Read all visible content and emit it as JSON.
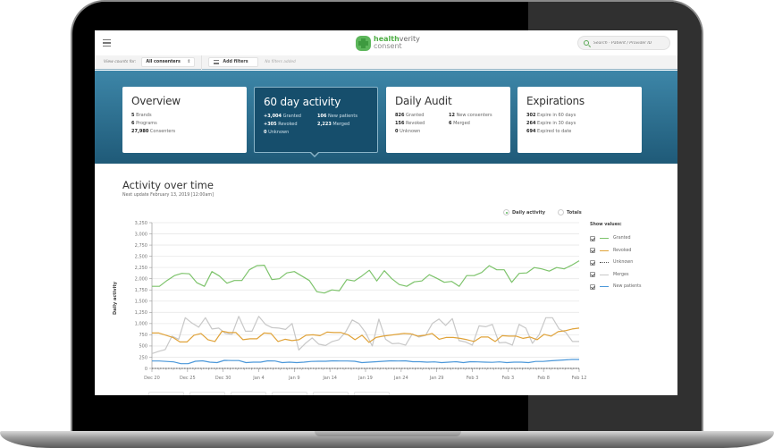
{
  "topbar": {
    "menu_icon": "hamburger-icon",
    "logo": {
      "brand_bold": "health",
      "brand_regular": "verity",
      "product": "consent"
    },
    "search": {
      "placeholder": "Search - Patient / Provider ID",
      "icon": "search-icon"
    }
  },
  "filterbar": {
    "view_counts_label": "View counts for:",
    "selected_view": "All consenters",
    "add_filters_label": "Add filters",
    "no_filters_text": "No filters added"
  },
  "cards": [
    {
      "title": "Overview",
      "stats": [
        {
          "value": "5",
          "label": "Brands"
        },
        {
          "value": "6",
          "label": "Programs"
        },
        {
          "value": "27,980",
          "label": "Consenters"
        }
      ]
    },
    {
      "title": "60 day activity",
      "active": true,
      "stats": [
        {
          "value": "+3,004",
          "label": "Granted"
        },
        {
          "value": "106",
          "label": "New patients"
        },
        {
          "value": "+305",
          "label": "Revoked"
        },
        {
          "value": "2,223",
          "label": "Merged"
        },
        {
          "value": "0",
          "label": "Unknown"
        }
      ]
    },
    {
      "title": "Daily Audit",
      "stats": [
        {
          "value": "826",
          "label": "Granted"
        },
        {
          "value": "12",
          "label": "New consenters"
        },
        {
          "value": "156",
          "label": "Revoked"
        },
        {
          "value": "6",
          "label": "Merged"
        },
        {
          "value": "0",
          "label": "Unknown"
        }
      ]
    },
    {
      "title": "Expirations",
      "stats": [
        {
          "value": "302",
          "label": "Expire in 60 days"
        },
        {
          "value": "264",
          "label": "Expire in 30 days"
        },
        {
          "value": "694",
          "label": "Expired to date"
        }
      ]
    }
  ],
  "activity": {
    "title": "Activity over time",
    "subtitle": "Next update February 13, 2019 [12:00am]",
    "mode_options": [
      {
        "label": "Daily activity",
        "selected": true
      },
      {
        "label": "Totals",
        "selected": false
      }
    ],
    "legend_title": "Show values:",
    "legend": [
      {
        "label": "Granted",
        "color": "#7dc36b",
        "checked": true,
        "style": "solid"
      },
      {
        "label": "Revoked",
        "color": "#e0a33a",
        "checked": true,
        "style": "solid"
      },
      {
        "label": "Unknown",
        "color": "#555555",
        "checked": true,
        "style": "dotted"
      },
      {
        "label": "Merges",
        "color": "#c8c8c8",
        "checked": true,
        "style": "solid"
      },
      {
        "label": "New patients",
        "color": "#4a97d9",
        "checked": true,
        "style": "solid"
      }
    ]
  },
  "chart_data": {
    "type": "line",
    "title": "Activity over time",
    "xlabel": "",
    "ylabel": "Daily activity",
    "ylim": [
      0,
      3250
    ],
    "yticks": [
      0,
      250,
      500,
      750,
      1000,
      1250,
      1500,
      1750,
      2000,
      2250,
      2500,
      2750,
      3000,
      3250
    ],
    "ytick_labels": [
      "0",
      "250",
      "500",
      "750",
      "1,000",
      "1,250",
      "1,500",
      "1,750",
      "2,000",
      "2,250",
      "2,500",
      "2,750",
      "3,000",
      "3,250"
    ],
    "xtick_labels": [
      "Dec 20",
      "Dec 25",
      "Dec 30",
      "Jan 4",
      "Jan 9",
      "Jan 14",
      "Jan 19",
      "Jan 24",
      "Jan 29",
      "Feb 3",
      "Feb 3",
      "Feb 8",
      "Feb 12"
    ],
    "grid": true,
    "legend_position": "right",
    "series": [
      {
        "name": "Granted",
        "color": "#7dc36b",
        "values": [
          1830,
          1830,
          1960,
          2070,
          2120,
          2110,
          1910,
          1830,
          2160,
          2060,
          1900,
          1960,
          1960,
          2200,
          2290,
          2300,
          1980,
          2000,
          2130,
          2160,
          2060,
          1960,
          1710,
          1680,
          1750,
          1730,
          1980,
          1950,
          2060,
          2190,
          1950,
          2180,
          2000,
          1870,
          1830,
          1930,
          1950,
          2090,
          2010,
          1920,
          1940,
          1830,
          2070,
          2070,
          2140,
          2290,
          2200,
          2200,
          1920,
          2120,
          2130,
          2250,
          2220,
          2170,
          2250,
          2220,
          2300,
          2400
        ]
      },
      {
        "name": "Revoked",
        "color": "#e0a33a",
        "values": [
          790,
          790,
          740,
          690,
          590,
          590,
          740,
          780,
          640,
          600,
          830,
          800,
          800,
          640,
          660,
          660,
          790,
          780,
          600,
          650,
          620,
          640,
          740,
          750,
          730,
          810,
          800,
          800,
          750,
          640,
          740,
          580,
          690,
          720,
          740,
          760,
          780,
          770,
          720,
          740,
          780,
          650,
          690,
          690,
          670,
          640,
          600,
          700,
          700,
          600,
          730,
          720,
          720,
          670,
          700,
          640,
          760,
          720,
          820,
          840,
          880,
          900
        ]
      },
      {
        "name": "Unknown",
        "color": "#555555",
        "values": [
          0,
          0,
          0,
          0,
          0,
          0,
          0,
          0,
          0,
          0,
          0,
          0,
          0,
          0,
          0,
          0,
          0,
          0,
          0,
          0,
          0,
          0,
          0,
          0,
          0,
          0,
          0,
          0,
          0,
          0,
          0,
          0,
          0,
          0,
          0,
          0,
          0,
          0,
          0,
          0,
          0,
          0,
          0,
          0,
          0,
          0,
          0,
          0,
          0,
          0,
          0,
          0,
          0,
          0,
          0,
          0,
          0,
          0,
          0,
          0,
          0,
          0
        ]
      },
      {
        "name": "Merges",
        "color": "#c8c8c8",
        "values": [
          330,
          380,
          420,
          720,
          650,
          1130,
          1010,
          920,
          1130,
          880,
          900,
          780,
          760,
          1160,
          830,
          830,
          1160,
          980,
          910,
          900,
          870,
          1000,
          410,
          560,
          680,
          540,
          510,
          600,
          640,
          810,
          1080,
          1000,
          800,
          500,
          1100,
          650,
          550,
          560,
          520,
          770,
          700,
          740,
          1000,
          1100,
          960,
          1110,
          620,
          590,
          520,
          950,
          930,
          980,
          570,
          580,
          520,
          980,
          900,
          560,
          750,
          1130,
          1130,
          880,
          800,
          600,
          600
        ]
      },
      {
        "name": "New patients",
        "color": "#4a97d9",
        "values": [
          165,
          165,
          155,
          145,
          105,
          105,
          160,
          170,
          140,
          130,
          180,
          175,
          175,
          130,
          140,
          140,
          170,
          165,
          130,
          140,
          130,
          140,
          155,
          160,
          160,
          170,
          165,
          165,
          160,
          130,
          140,
          150,
          160,
          170,
          165,
          170,
          150,
          150,
          140,
          145,
          130,
          140,
          150,
          130,
          150,
          145,
          140,
          135,
          145,
          130,
          140,
          140,
          130,
          155,
          155,
          170,
          180,
          190,
          200,
          200
        ]
      }
    ]
  }
}
